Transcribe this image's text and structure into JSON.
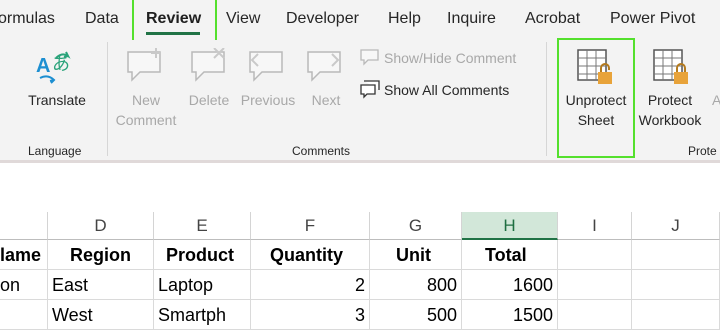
{
  "tabs": [
    {
      "label": "ormulas"
    },
    {
      "label": "Data"
    },
    {
      "label": "Review"
    },
    {
      "label": "View"
    },
    {
      "label": "Developer"
    },
    {
      "label": "Help"
    },
    {
      "label": "Inquire"
    },
    {
      "label": "Acrobat"
    },
    {
      "label": "Power Pivot"
    }
  ],
  "ribbon": {
    "language": {
      "translate_label": "Translate",
      "group_label": "Language"
    },
    "comments": {
      "new_comment_l1": "New",
      "new_comment_l2": "Comment",
      "delete_label": "Delete",
      "previous_label": "Previous",
      "next_label": "Next",
      "show_hide_label": "Show/Hide Comment",
      "show_all_label": "Show All Comments",
      "group_label": "Comments"
    },
    "protect": {
      "unprotect_sheet_l1": "Unprotect",
      "unprotect_sheet_l2": "Sheet",
      "protect_workbook_l1": "Protect",
      "protect_workbook_l2": "Workbook",
      "cut_label": "A",
      "group_label": "Prote"
    }
  },
  "colors": {
    "accent_green": "#217346",
    "highlight_box": "#54e02d",
    "lock_orange": "#e8a33a",
    "translate_blue": "#1d8fd1",
    "translate_teal": "#2aa37a"
  },
  "grid": {
    "columns": [
      "D",
      "E",
      "F",
      "G",
      "H",
      "I",
      "J"
    ],
    "header_row": [
      "lame",
      "Region",
      "Product",
      "Quantity",
      "Unit",
      "Total"
    ],
    "rows": [
      [
        "on",
        "East",
        "Laptop",
        "2",
        "800",
        "1600"
      ],
      [
        "",
        "West",
        "Smartph",
        "3",
        "500",
        "1500"
      ]
    ]
  }
}
